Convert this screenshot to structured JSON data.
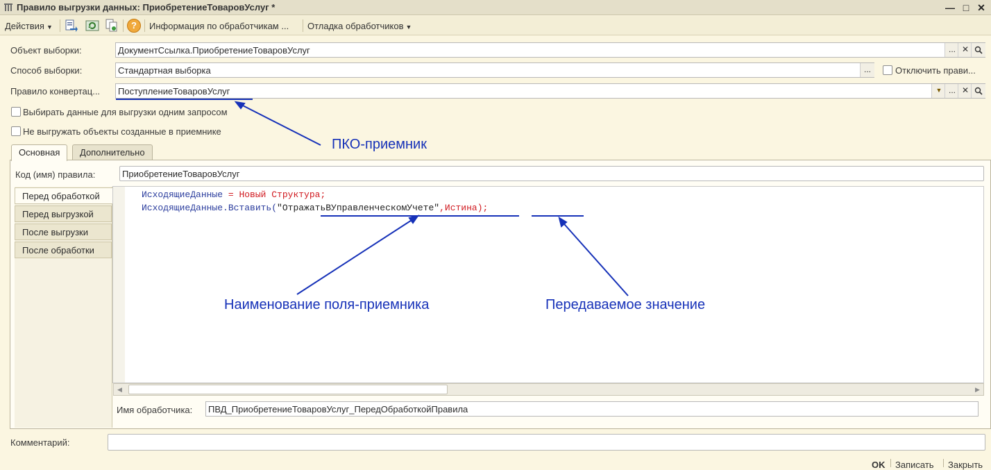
{
  "window": {
    "title": "Правило выгрузки данных: ПриобретениеТоваровУслуг *",
    "controls": [
      "—",
      "□",
      "✕"
    ]
  },
  "toolbar": {
    "actions_label": "Действия",
    "info_label": "Информация по обработчикам ...",
    "debug_label": "Отладка обработчиков",
    "help_glyph": "?"
  },
  "fields": {
    "object_label": "Объект выборки:",
    "object_value": "ДокументСсылка.ПриобретениеТоваровУслуг",
    "method_label": "Способ выборки:",
    "method_value": "Стандартная выборка",
    "disable_rule_label": "Отключить прави...",
    "rule_label": "Правило конвертац...",
    "rule_value": "ПоступлениеТоваровУслуг",
    "buttons": {
      "ellipsis": "...",
      "clear": "✕",
      "dropdown": "▼"
    }
  },
  "checkboxes": {
    "single_query": "Выбирать данные для выгрузки одним запросом",
    "not_export_created": "Не выгружать объекты созданные в приемнике"
  },
  "tabs": [
    "Основная",
    "Дополнительно"
  ],
  "rule_code": {
    "label": "Код (имя) правила:",
    "value": "ПриобретениеТоваровУслуг"
  },
  "handlers": [
    "Перед обработкой",
    "Перед выгрузкой",
    "После выгрузки",
    "После обработки"
  ],
  "code": {
    "line1": {
      "var": "ИсходящиеДанные",
      "op": " = ",
      "new_kw": "Новый Структура;"
    },
    "line2": {
      "call": "ИсходящиеДанные.Вставить(",
      "str": "\"ОтражатьВУправленческомУчете\"",
      "comma": ",",
      "value": "Истина",
      "end": ");"
    }
  },
  "handler_name": {
    "label": "Имя обработчика:",
    "value": "ПВД_ПриобретениеТоваровУслуг_ПередОбработкойПравила"
  },
  "comment_label": "Комментарий:",
  "annotations": {
    "pko": "ПКО-приемник",
    "field_name": "Наименование поля-приемника",
    "passed_value": "Передаваемое значение"
  },
  "footer": {
    "ok": "OK",
    "save": "Записать",
    "close": "Закрыть"
  },
  "colors": {
    "annotation": "#1631b8",
    "keyword": "#2a3c9d",
    "literal": "#d0191f",
    "background": "#fbf6e1"
  }
}
